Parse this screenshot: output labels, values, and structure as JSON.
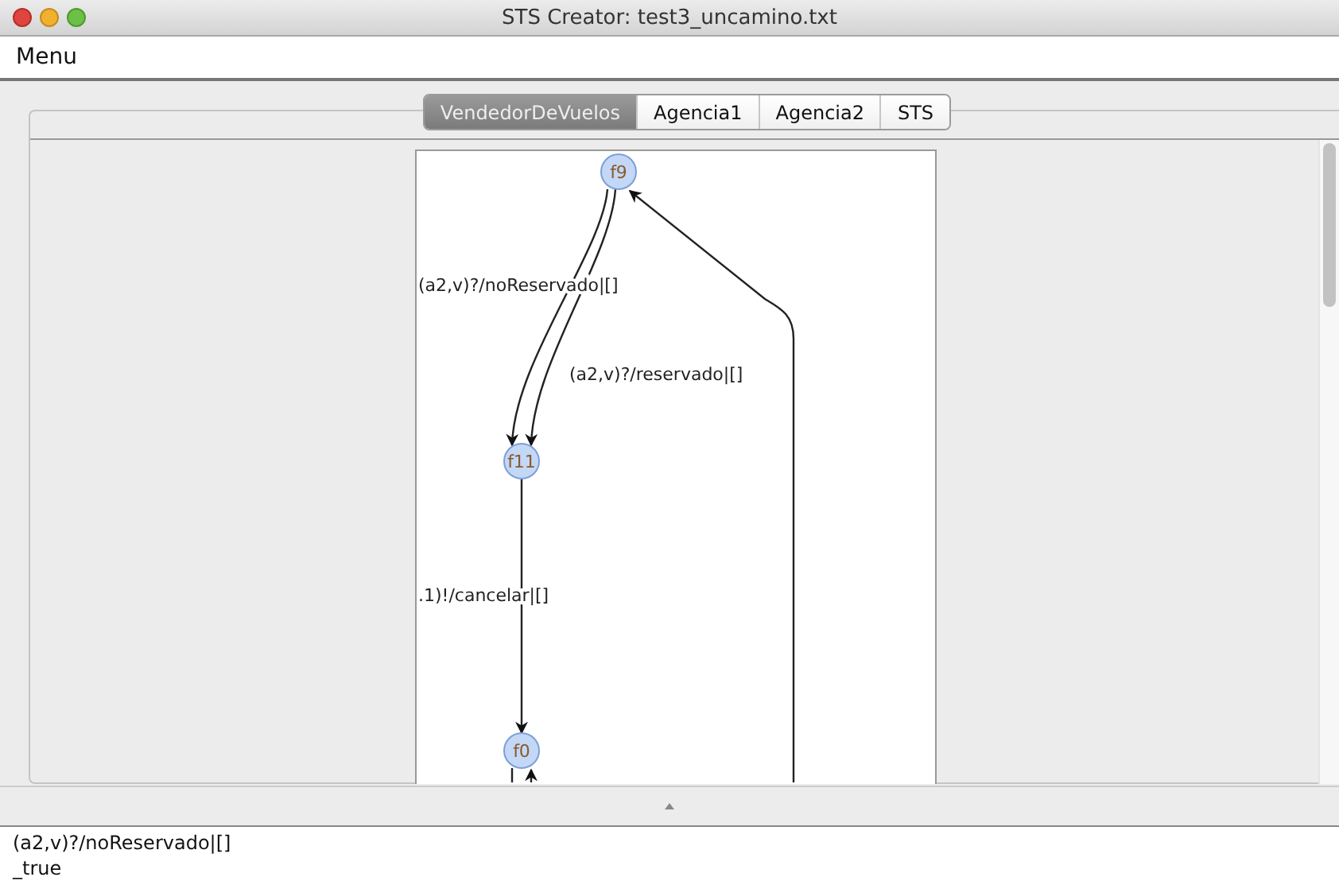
{
  "window": {
    "title": "STS Creator: test3_uncamino.txt"
  },
  "menu_bar": [
    {
      "label": "Menu"
    }
  ],
  "tabs": [
    {
      "label": "VendedorDeVuelos",
      "selected": true
    },
    {
      "label": "Agencia1",
      "selected": false
    },
    {
      "label": "Agencia2",
      "selected": false
    },
    {
      "label": "STS",
      "selected": false
    }
  ],
  "diagram": {
    "states": [
      {
        "label": "f9"
      },
      {
        "label": "f11"
      },
      {
        "label": "f0"
      }
    ],
    "transitions": [
      {
        "label": "(a2,v)?/noReservado|[]"
      },
      {
        "label": "(a2,v)?/reservado|[]"
      },
      {
        "label": ".1)!/cancelar|[]"
      }
    ]
  },
  "details": [
    "(a2,v)?/noReservado|[]",
    "_true"
  ]
}
